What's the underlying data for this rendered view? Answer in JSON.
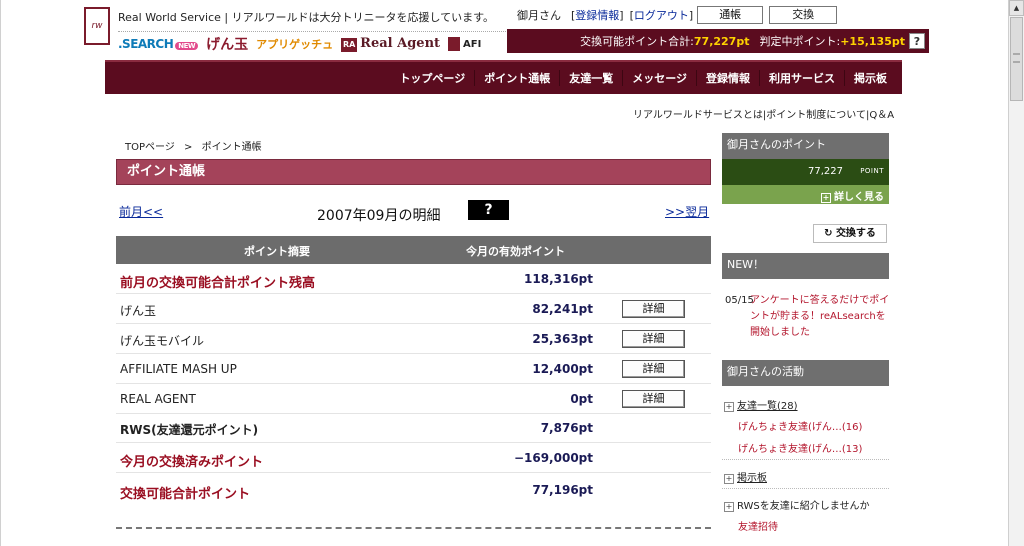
{
  "header": {
    "logo_text": "rw",
    "brand_line": "Real World Service | リアルワールドは大分トリニータを応援しています。",
    "partners": {
      "search": ".SEARCH",
      "search_badge": "NEW",
      "gendama": "げん玉",
      "appli": "アプリゲッチュ",
      "real_agent_mark": "RA",
      "real_agent": "Real Agent",
      "afi": "AFI"
    },
    "user": {
      "name": "御月さん",
      "link_profile": "登録情報",
      "link_logout": "ログアウト",
      "bracket_open": "[",
      "bracket_close": "]",
      "btn_passbook": "通帳",
      "btn_exchange": "交換"
    },
    "points": {
      "exchangeable_label": "交換可能ポイント合計:",
      "exchangeable_value": "77,227pt",
      "pending_label": "判定中ポイント:",
      "pending_value": "+15,135pt",
      "help": "?"
    }
  },
  "nav": [
    "トップページ",
    "ポイント通帳",
    "友達一覧",
    "メッセージ",
    "登録情報",
    "利用サービス",
    "掲示板"
  ],
  "subnav": {
    "about": "リアルワールドサービスとは",
    "system": "ポイント制度について",
    "qa": "Q＆A",
    "sep": "|"
  },
  "breadcrumb": {
    "top": "TOPページ",
    "sep": ">",
    "current": "ポイント通帳"
  },
  "page_title": "ポイント通帳",
  "month_nav": {
    "prev": "前月<<",
    "title": "2007年09月の明細",
    "help": "?",
    "next": ">>翌月"
  },
  "table": {
    "headers": {
      "summary": "ポイント摘要",
      "valid": "今月の有効ポイント"
    },
    "rows": [
      {
        "label": "前月の交換可能合計ポイント残高",
        "value": "118,316pt"
      },
      {
        "label": "げん玉",
        "value": "82,241pt",
        "button": "詳細"
      },
      {
        "label": "げん玉モバイル",
        "value": "25,363pt",
        "button": "詳細"
      },
      {
        "label": "AFFILIATE MASH UP",
        "value": "12,400pt",
        "button": "詳細"
      },
      {
        "label": "REAL AGENT",
        "value": "0pt",
        "button": "詳細"
      },
      {
        "label": "RWS(友達還元ポイント)",
        "value": "7,876pt"
      },
      {
        "label": "今月の交換済みポイント",
        "value": "−169,000pt"
      },
      {
        "label": "交換可能合計ポイント",
        "value": "77,196pt"
      }
    ]
  },
  "sidebar": {
    "points_title": "御月さんのポイント",
    "points_value": "77,227",
    "points_unit": "POINT",
    "more_icon": "+",
    "more": "詳しく見る",
    "exchange_icon": "↻",
    "exchange_btn": "交換する",
    "news_title": "NEW！",
    "news_date": "05/15",
    "news_text": "アンケートに答えるだけでポイントが貯まる！reALsearchを開始しました",
    "activity_title": "御月さんの活動",
    "friends_link": "友達一覧(28)",
    "friend1": "げんちょき友達(げん…(16)",
    "friend2": "げんちょき友達(げん…(13)",
    "board_link": "掲示板",
    "invite_text": "RWSを友達に紹介しませんか",
    "invite_link": "友達招待"
  },
  "scrollbar": {
    "up_arrow": "▲"
  }
}
